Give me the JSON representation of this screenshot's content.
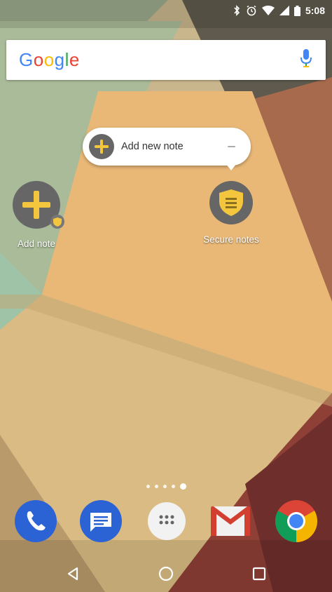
{
  "status_bar": {
    "time": "5:08"
  },
  "search": {
    "logo_text": [
      "G",
      "o",
      "o",
      "g",
      "l",
      "e"
    ]
  },
  "shortcut_popup": {
    "label": "Add new note"
  },
  "desktop": {
    "apps": [
      {
        "label": "Add note",
        "icon": "add-note-icon"
      },
      {
        "label": "Secure notes",
        "icon": "secure-notes-icon"
      }
    ]
  },
  "page_indicator": {
    "count": 5,
    "active_index": 4
  },
  "dock": {
    "apps": [
      {
        "name": "phone",
        "icon": "phone-icon"
      },
      {
        "name": "messages",
        "icon": "messages-icon"
      },
      {
        "name": "app-drawer",
        "icon": "app-drawer-icon"
      },
      {
        "name": "gmail",
        "icon": "gmail-icon"
      },
      {
        "name": "chrome",
        "icon": "chrome-icon"
      }
    ]
  },
  "nav_bar": {
    "buttons": [
      "back",
      "home",
      "recents"
    ]
  },
  "colors": {
    "accent_yellow": "#f4c63d",
    "icon_gray": "#666666",
    "phone_blue": "#2b62d4",
    "gmail_red": "#d23f31"
  }
}
